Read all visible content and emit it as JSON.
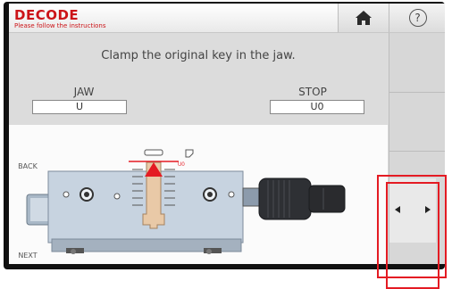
{
  "header": {
    "title": "DECODE",
    "subtitle": "Please follow the instructions"
  },
  "toolbar": {
    "home_icon": "home-icon",
    "help_label": "?"
  },
  "main": {
    "instruction": "Clamp the original key in the jaw.",
    "jaw_label": "JAW",
    "jaw_value": "U",
    "stop_label": "STOP",
    "stop_value": "U0",
    "diagram_stop_marker": "U0"
  },
  "nav": {
    "back_label": "BACK",
    "next_label": "NEXT"
  },
  "colors": {
    "brand_red": "#cc1418",
    "highlight_red": "#e41b23",
    "knob": "#2e3034",
    "key": "#e9c9a7",
    "jaw_body": "#c7d3e0"
  }
}
